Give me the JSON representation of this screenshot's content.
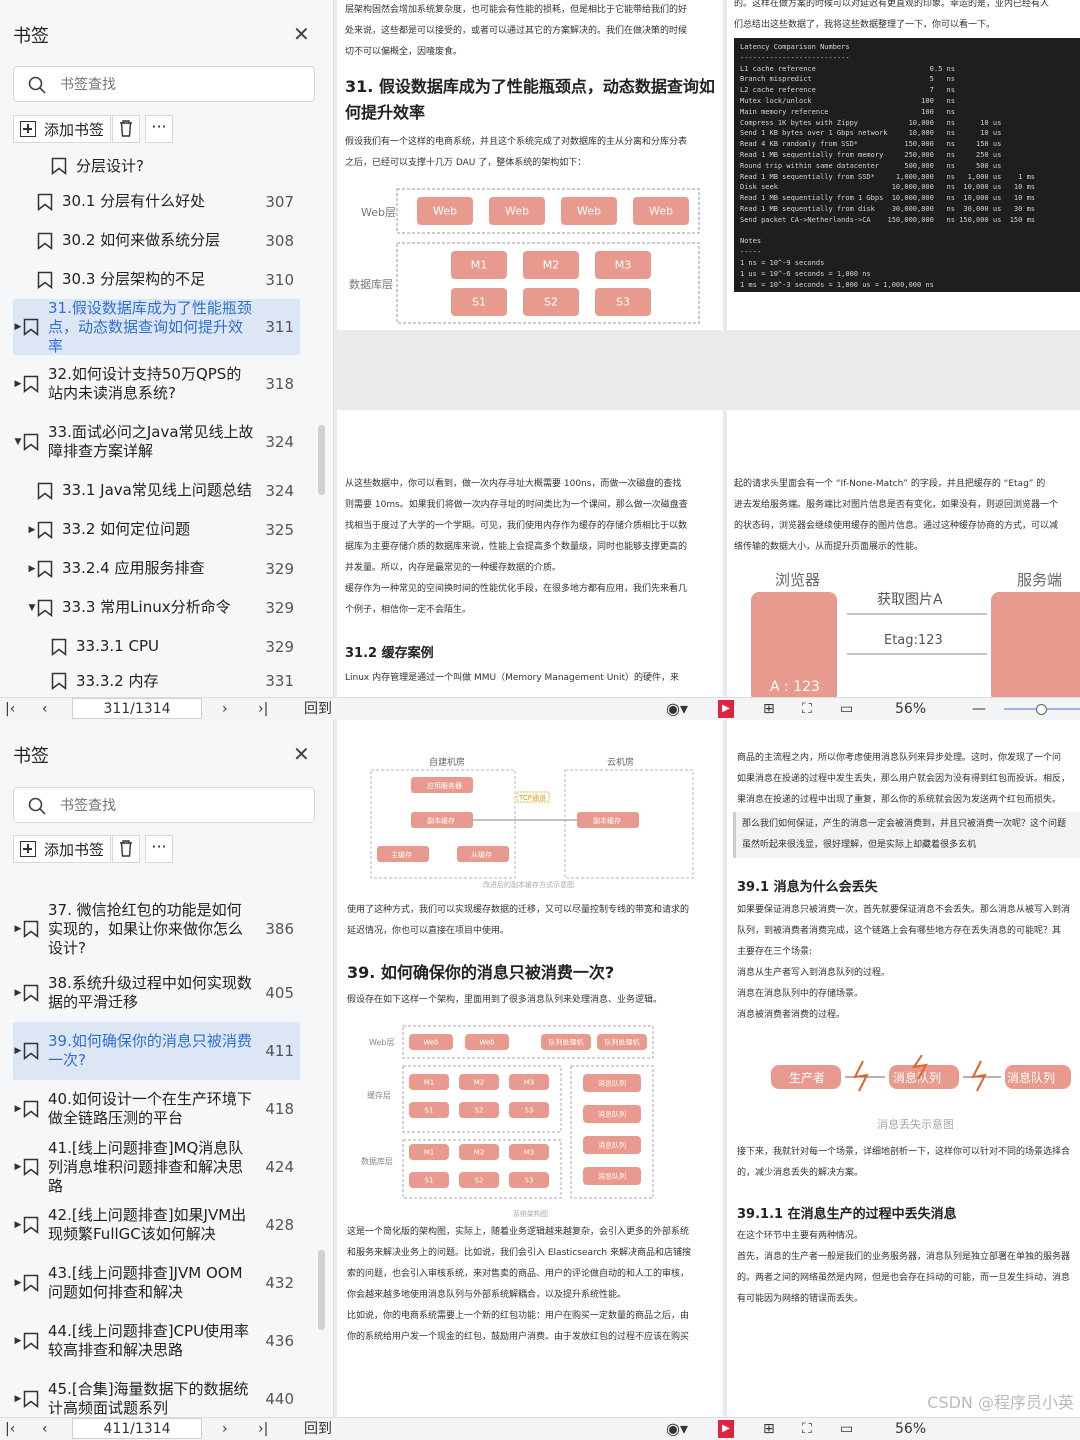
{
  "top": {
    "sidebar": {
      "title": "书签",
      "search_placeholder": "书签查找",
      "add_label": "添加书签",
      "items": [
        {
          "text": "分层设计?",
          "page": "",
          "tri": "",
          "indent": 2
        },
        {
          "text": "30.1 分层有什么好处",
          "page": "307",
          "tri": "",
          "indent": 1
        },
        {
          "text": "30.2 如何来做系统分层",
          "page": "308",
          "tri": "",
          "indent": 1
        },
        {
          "text": "30.3 分层架构的不足",
          "page": "310",
          "tri": "",
          "indent": 1
        },
        {
          "text": "31.假设数据库成为了性能瓶颈点，动态数据查询如何提升效率",
          "page": "311",
          "tri": "▶",
          "indent": 0,
          "selected": true
        },
        {
          "text": "32.如何设计支持50万QPS的站内未读消息系统?",
          "page": "318",
          "tri": "▶",
          "indent": 0
        },
        {
          "text": "33.面试必问之Java常见线上故障排查方案详解",
          "page": "324",
          "tri": "▼",
          "indent": 0
        },
        {
          "text": "33.1 Java常见线上问题总结",
          "page": "324",
          "tri": "",
          "indent": 1
        },
        {
          "text": "33.2 如何定位问题",
          "page": "325",
          "tri": "▶",
          "indent": 1
        },
        {
          "text": "33.2.4 应用服务排查",
          "page": "329",
          "tri": "▶",
          "indent": 1
        },
        {
          "text": "33.3 常用Linux分析命令",
          "page": "329",
          "tri": "▼",
          "indent": 1
        },
        {
          "text": "33.3.1 CPU",
          "page": "329",
          "tri": "",
          "indent": 2
        },
        {
          "text": "33.3.2 内存",
          "page": "331",
          "tri": "",
          "indent": 2
        }
      ]
    },
    "toolbar": {
      "page": "311/1314",
      "back": "回到",
      "zoom": "56%"
    },
    "doc": {
      "left_top_lines": [
        "层架构固然会增加系统复杂度，也可能会有性能的损耗，但是相比于它能带给我们的好",
        "处来说，这些都是可以接受的，或者可以通过其它的方案解决的。我们在做决策的时候",
        "切不可以偏概全，因噎废食。"
      ],
      "heading": "31. 假设数据库成为了性能瓶颈点，动态数据查询如何提升效率",
      "intro": [
        "假设我们有一个这样的电商系统，并且这个系统完成了对数据库的主从分离和分库分表",
        "之后，已经可以支撑十几万 DAU 了，整体系统的架构如下："
      ],
      "diagram": {
        "web_label": "Web层",
        "db_label": "数据库层",
        "web_nodes": [
          "Web",
          "Web",
          "Web",
          "Web"
        ],
        "m_nodes": [
          "M1",
          "M2",
          "M3"
        ],
        "s_nodes": [
          "S1",
          "S2",
          "S3"
        ]
      },
      "right_top": [
        "的。这样在做方案的时候可以对延迟有更直观的印象。幸运的是，业内已经有人",
        "们总结出这些数据了，我将这些数据整理了一下，你可以看一下。"
      ],
      "terminal": "Latency Comparison Numbers\n--------------------------\nL1 cache reference                           0.5 ns\nBranch mispredict                            5   ns\nL2 cache reference                           7   ns\nMutex lock/unlock                          100   ns\nMain memory reference                      100   ns\nCompress 1K bytes with Zippy            10,000   ns      10 us\nSend 1 KB bytes over 1 Gbps network     10,000   ns      10 us\nRead 4 KB randomly from SSD*           150,000   ns     150 us\nRead 1 MB sequentially from memory     250,000   ns     250 us\nRound trip within same datacenter      500,000   ns     500 us\nRead 1 MB sequentially from SSD*     1,000,000   ns   1,000 us    1 ms\nDisk seek                           10,000,000   ns  10,000 us   10 ms\nRead 1 MB sequentially from 1 Gbps  10,000,000   ns  10,000 us   10 ms\nRead 1 MB sequentially from disk    30,000,000   ns  30,000 us   30 ms\nSend packet CA->Netherlands->CA    150,000,000   ns 150,000 us  150 ms\n\nNotes\n-----\n1 ns = 10^-9 seconds\n1 us = 10^-6 seconds = 1,000 ns\n1 ms = 10^-3 seconds = 1,000 us = 1,000,000 ns",
      "mid_lines": [
        "从这些数据中，你可以看到，做一次内存寻址大概需要 100ns，而做一次磁盘的查找",
        "则需要 10ms。如果我们将做一次内存寻址的时间类比为一个课间，那么做一次磁盘查",
        "找相当于度过了大学的一个学期。可见，我们使用内存作为缓存的存储介质相比于以数",
        "据库为主要存储介质的数据库来说，性能上会提高多个数量级，同时也能够支撑更高的",
        "并发量。所以，内存是最常见的一种缓存数据的介质。",
        "缓存作为一种常见的空间换时间的性能优化手段，在很多地方都有应用，我们先来看几",
        "个例子，相信你一定不会陌生。"
      ],
      "h312": "31.2 缓存案例",
      "mmu_line": "Linux 内存管理是通过一个叫做 MMU（Memory Management Unit）的硬件，来",
      "right_mid": [
        "起的请求头里面会有一个 “If-None-Match” 的字段，并且把缓存的 “Etag” 的",
        "进去发给服务端。服务端比对图片信息是否有变化，如果没有，则返回浏览器一个",
        "的状态码，浏览器会继续使用缓存的图片信息。通过这种缓存协商的方式，可以减",
        "络传输的数据大小，从而提升页面展示的性能。"
      ],
      "etag": {
        "browser": "浏览器",
        "server": "服务端",
        "req": "获取图片A",
        "tag": "Etag:123",
        "a": "A : 123"
      }
    }
  },
  "bottom": {
    "sidebar": {
      "title": "书签",
      "search_placeholder": "书签查找",
      "add_label": "添加书签",
      "items": [
        {
          "text": "37. 微信抢红包的功能是如何实现的，如果让你来做你怎么设计?",
          "page": "386",
          "tri": "▶",
          "indent": 0
        },
        {
          "text": "38.系统升级过程中如何实现数据的平滑迁移",
          "page": "405",
          "tri": "▶",
          "indent": 0
        },
        {
          "text": "39.如何确保你的消息只被消费一次?",
          "page": "411",
          "tri": "▶",
          "indent": 0,
          "selected": true
        },
        {
          "text": "40.如何设计一个在生产环境下做全链路压测的平台",
          "page": "418",
          "tri": "▶",
          "indent": 0
        },
        {
          "text": "41.[线上问题排查]MQ消息队列消息堆积问题排查和解决思路",
          "page": "424",
          "tri": "▶",
          "indent": 0
        },
        {
          "text": "42.[线上问题排查]如果JVM出现频繁FullGC该如何解决",
          "page": "428",
          "tri": "▶",
          "indent": 0
        },
        {
          "text": "43.[线上问题排查]JVM OOM问题如何排查和解决",
          "page": "432",
          "tri": "▶",
          "indent": 0
        },
        {
          "text": "44.[线上问题排查]CPU使用率较高排查和解决思路",
          "page": "436",
          "tri": "▶",
          "indent": 0
        },
        {
          "text": "45.[合集]海量数据下的数据统计高频面试题系列",
          "page": "440",
          "tri": "▶",
          "indent": 0
        }
      ]
    },
    "toolbar": {
      "page": "411/1314",
      "back": "回到",
      "zoom": "56%"
    },
    "doc": {
      "mig": {
        "left_title": "自建机房",
        "right_title": "云机房",
        "app": "应用服务器",
        "copy1": "副本缓存",
        "copy2": "副本缓存",
        "src": "主缓存",
        "dst": "从缓存",
        "link": "TCP通道",
        "caption": "改进后的副本缓存方式示意图"
      },
      "mig_text": [
        "使用了这种方式，我们可以实现缓存数据的迁移，又可以尽量控制专线的带宽和请求的",
        "延迟情况，你也可以直接在项目中使用。"
      ],
      "h39": "39. 如何确保你的消息只被消费一次?",
      "h39_intro": "假设存在如下这样一个架构，里面用到了很多消息队列来处理消息、业务逻辑。",
      "arch": {
        "web_label": "Web层",
        "cache_label": "缓存层",
        "db_label": "数据库层",
        "web_nodes": [
          "Web",
          "Web"
        ],
        "q_nodes": [
          "队列处理机",
          "队列处理机"
        ],
        "m_nodes": [
          "M1",
          "M2",
          "M3"
        ],
        "s_nodes": [
          "S1",
          "S2",
          "S3"
        ],
        "mq": [
          "消息队列",
          "消息队列",
          "消息队列",
          "消息队列"
        ],
        "caption": "系统架构图"
      },
      "body_lines": [
        "这是一个简化版的架构图，实际上，随着业务逻辑越来越复杂，会引入更多的外部系统",
        "和服务来解决业务上的问题。比如说，我们会引入 Elasticsearch 来解决商品和店铺搜",
        "索的问题，也会引入审核系统，来对售卖的商品、用户的评论做自动的和人工的审核，",
        "你会越来越多地使用消息队列与外部系统解耦合，以及提升系统性能。",
        "比如说，你的电商系统需要上一个新的红包功能：用户在购买一定数量的商品之后，由",
        "你的系统给用户发一个现金的红包，鼓励用户消费。由于发放红包的过程不应该在购买"
      ],
      "right_lines": [
        "商品的主流程之内，所以你考虑使用消息队列来异步处理。这时，你发现了一个问",
        "如果消息在投递的过程中发生丢失，那么用户就会因为没有得到红包而投诉。相反，",
        "果消息在投递的过程中出现了重复，那么你的系统就会因为发送两个红包而损失。"
      ],
      "quote": [
        "那么我们如何保证，产生的消息一定会被消费到，并且只被消费一次呢？这个问题",
        "虽然听起来很浅显，很好理解，但是实际上却藏着很多玄机"
      ],
      "h391": "39.1 消息为什么会丢失",
      "r391": [
        "如果要保证消息只被消费一次，首先就要保证消息不会丢失。那么消息从被写入到消",
        "队列，到被消费者消费完成，这个链路上会有哪些地方存在丢失消息的可能呢？其",
        "主要存在三个场景:",
        "消息从生产者写入到消息队列的过程。",
        "消息在消息队列中的存储场景。",
        "消息被消费者消费的过程。"
      ],
      "flow": {
        "producer": "生产者",
        "mq1": "消息队列",
        "mq2": "消息队列",
        "caption": "消息丢失示意图"
      },
      "r_after": [
        "接下来，我就针对每一个场景，详细地剖析一下，这样你可以针对不同的场景选择合",
        "的，减少消息丢失的解决方案。"
      ],
      "h3911": "39.1.1 在消息生产的过程中丢失消息",
      "r3911": [
        "在这个环节中主要有两种情况。",
        "首先，消息的生产者一般是我们的业务服务器，消息队列是独立部署在单独的服务器",
        "的。两者之间的网络虽然是内网，但是也会存在抖动的可能，而一旦发生抖动，消息",
        "有可能因为网络的错误而丢失。"
      ],
      "watermark": "CSDN @程序员小英"
    }
  },
  "colors": {
    "accent": "#e88c7d",
    "select_bg": "#dde6f5",
    "select_fg": "#2f6fd3",
    "red_btn": "#e02341"
  }
}
